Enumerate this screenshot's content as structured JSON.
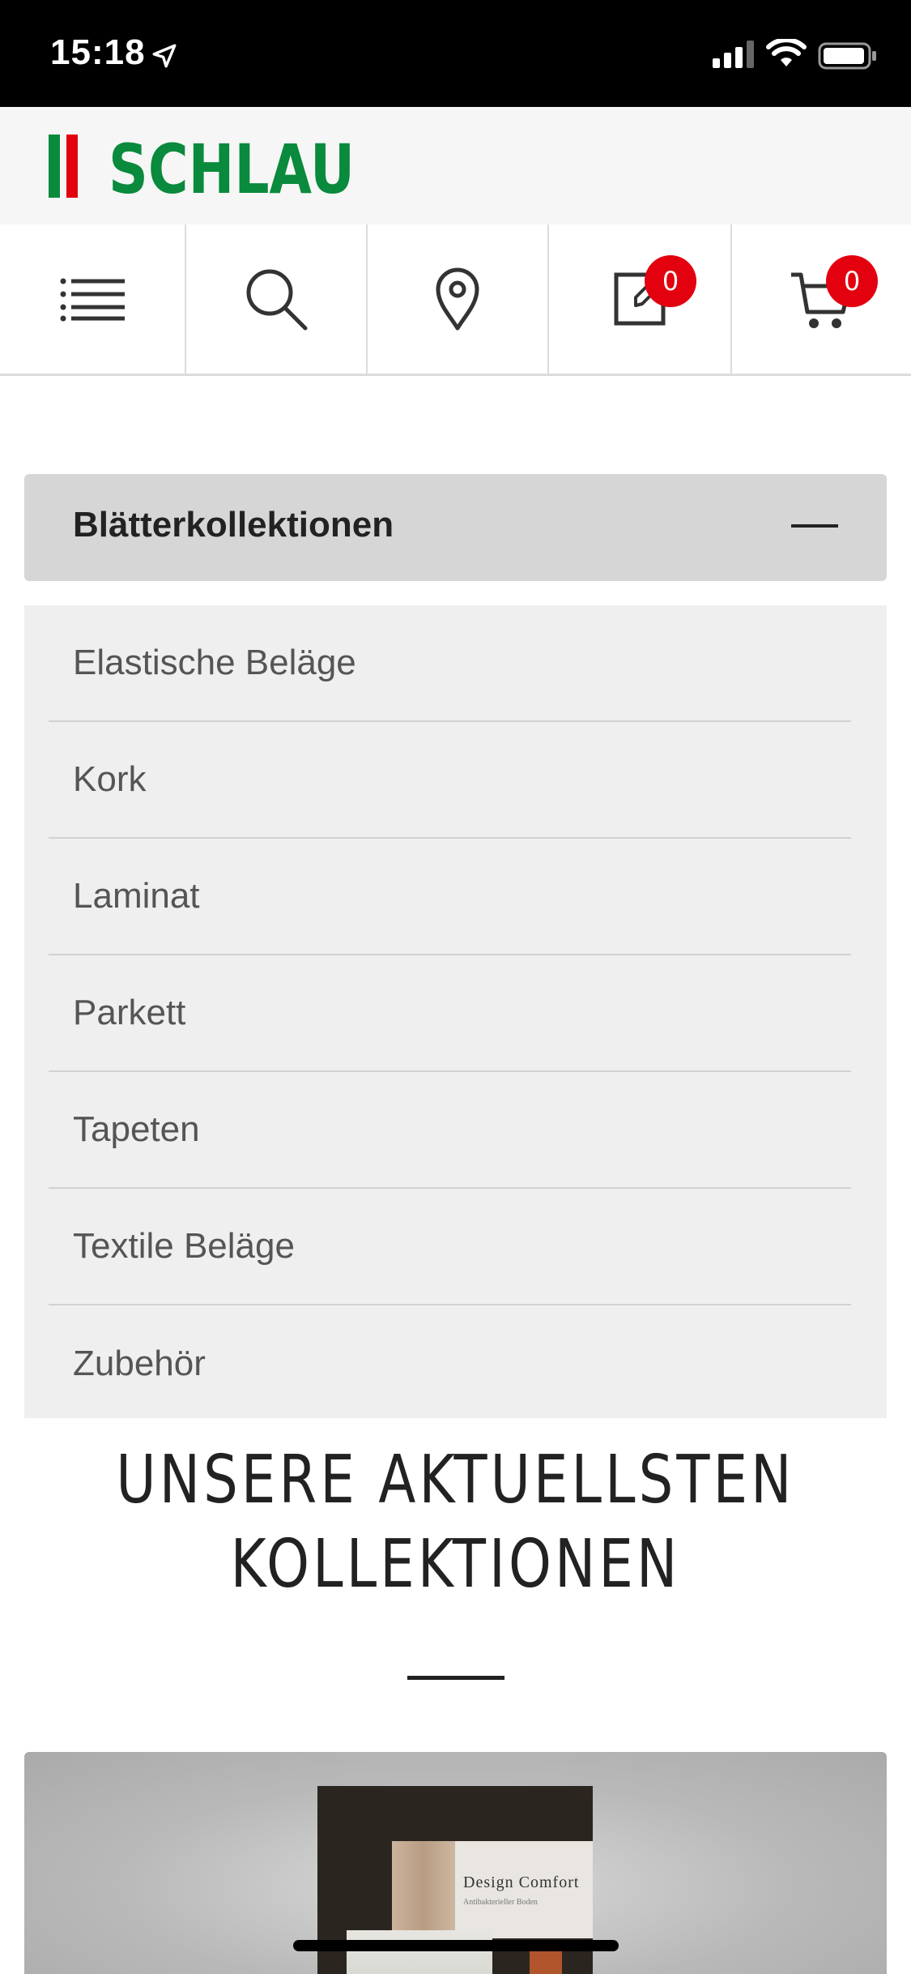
{
  "status_bar": {
    "time": "15:18",
    "icons": [
      "location-arrow-icon",
      "cellular-signal-icon",
      "wifi-icon",
      "battery-icon"
    ]
  },
  "header": {
    "logo_text": "SCHLAU",
    "logo_color": "#0a8a3c",
    "stripe_colors": [
      "#0a8a3c",
      "#e3000f"
    ]
  },
  "toolbar": {
    "items": [
      {
        "icon": "menu-icon"
      },
      {
        "icon": "search-icon"
      },
      {
        "icon": "location-pin-icon"
      },
      {
        "icon": "edit-note-icon",
        "badge": "0"
      },
      {
        "icon": "cart-icon",
        "badge": "0"
      }
    ],
    "badge_color": "#e3000f"
  },
  "accordion": {
    "title": "Blätterkollektionen",
    "expanded": true,
    "items": [
      {
        "label": "Elastische Beläge"
      },
      {
        "label": "Kork"
      },
      {
        "label": "Laminat"
      },
      {
        "label": "Parkett"
      },
      {
        "label": "Tapeten"
      },
      {
        "label": "Textile Beläge"
      },
      {
        "label": "Zubehör"
      }
    ]
  },
  "section": {
    "title_line1": "UNSERE AKTUELLSTEN",
    "title_line2": "KOLLEKTIONEN"
  },
  "collection_card": {
    "catalog_title": "Design Comfort",
    "catalog_subtitle": "Antibakterieller Boden"
  }
}
